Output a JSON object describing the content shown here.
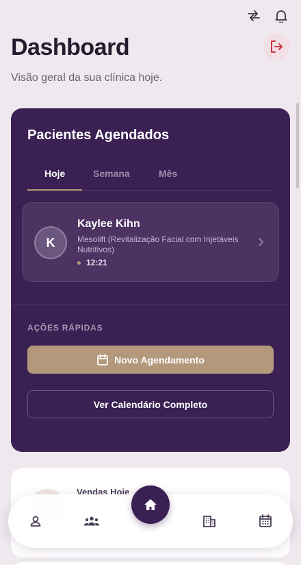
{
  "header": {
    "title": "Dashboard",
    "subtitle": "Visão geral da sua clínica hoje."
  },
  "icons": {
    "switch": "swap-arrows-icon",
    "notifications": "bell-icon",
    "logout": "logout-icon"
  },
  "appointments": {
    "title": "Pacientes Agendados",
    "tabs": [
      {
        "label": "Hoje",
        "active": true
      },
      {
        "label": "Semana",
        "active": false
      },
      {
        "label": "Mês",
        "active": false
      }
    ],
    "patients": [
      {
        "initial": "K",
        "name": "Kaylee Kihn",
        "procedure": "Mesolift (Revitalização Facial com Injetáveis Nutritivos)",
        "time": "12:21"
      }
    ]
  },
  "quick_actions": {
    "label": "AÇÕES RÁPIDAS",
    "new_appointment": "Novo Agendamento",
    "full_calendar": "Ver Calendário Completo"
  },
  "sales": {
    "label": "Vendas Hoje"
  },
  "nav": {
    "items": [
      "profile-icon",
      "patients-icon",
      "home-icon",
      "building-icon",
      "calendar-icon"
    ]
  },
  "colors": {
    "primary": "#3b2053",
    "accent": "#b3987c",
    "background": "#efe8ee",
    "logout": "#c8344a"
  }
}
